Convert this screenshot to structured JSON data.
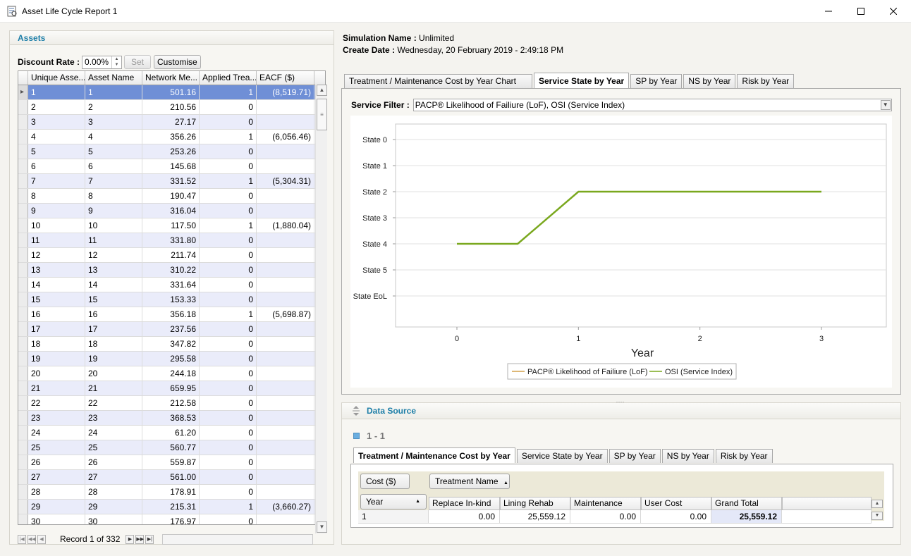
{
  "window": {
    "title": "Asset Life Cycle Report 1",
    "minimize_icon": "minimize-icon",
    "maximize_icon": "maximize-icon",
    "close_icon": "close-icon"
  },
  "assets": {
    "header": "Assets",
    "discount_rate_label": "Discount Rate :",
    "discount_rate_value": "0.00%",
    "set_label": "Set",
    "customise_label": "Customise",
    "columns": [
      "Unique Asse...",
      "Asset Name",
      "Network Me...",
      "Applied Trea...",
      "EACF ($)"
    ],
    "rows": [
      [
        "1",
        "1",
        "501.16",
        "1",
        "(8,519.71)"
      ],
      [
        "2",
        "2",
        "210.56",
        "0",
        ""
      ],
      [
        "3",
        "3",
        "27.17",
        "0",
        ""
      ],
      [
        "4",
        "4",
        "356.26",
        "1",
        "(6,056.46)"
      ],
      [
        "5",
        "5",
        "253.26",
        "0",
        ""
      ],
      [
        "6",
        "6",
        "145.68",
        "0",
        ""
      ],
      [
        "7",
        "7",
        "331.52",
        "1",
        "(5,304.31)"
      ],
      [
        "8",
        "8",
        "190.47",
        "0",
        ""
      ],
      [
        "9",
        "9",
        "316.04",
        "0",
        ""
      ],
      [
        "10",
        "10",
        "117.50",
        "1",
        "(1,880.04)"
      ],
      [
        "11",
        "11",
        "331.80",
        "0",
        ""
      ],
      [
        "12",
        "12",
        "211.74",
        "0",
        ""
      ],
      [
        "13",
        "13",
        "310.22",
        "0",
        ""
      ],
      [
        "14",
        "14",
        "331.64",
        "0",
        ""
      ],
      [
        "15",
        "15",
        "153.33",
        "0",
        ""
      ],
      [
        "16",
        "16",
        "356.18",
        "1",
        "(5,698.87)"
      ],
      [
        "17",
        "17",
        "237.56",
        "0",
        ""
      ],
      [
        "18",
        "18",
        "347.82",
        "0",
        ""
      ],
      [
        "19",
        "19",
        "295.58",
        "0",
        ""
      ],
      [
        "20",
        "20",
        "244.18",
        "0",
        ""
      ],
      [
        "21",
        "21",
        "659.95",
        "0",
        ""
      ],
      [
        "22",
        "22",
        "212.58",
        "0",
        ""
      ],
      [
        "23",
        "23",
        "368.53",
        "0",
        ""
      ],
      [
        "24",
        "24",
        "61.20",
        "0",
        ""
      ],
      [
        "25",
        "25",
        "560.77",
        "0",
        ""
      ],
      [
        "26",
        "26",
        "559.87",
        "0",
        ""
      ],
      [
        "27",
        "27",
        "561.00",
        "0",
        ""
      ],
      [
        "28",
        "28",
        "178.91",
        "0",
        ""
      ],
      [
        "29",
        "29",
        "215.31",
        "1",
        "(3,660.27)"
      ],
      [
        "30",
        "30",
        "176.97",
        "0",
        ""
      ]
    ],
    "record_text": "Record 1 of 332"
  },
  "simulation": {
    "name_label": "Simulation Name :",
    "name_value": "Unlimited",
    "date_label": "Create Date :",
    "date_value": "Wednesday, 20 February 2019 - 2:49:18 PM"
  },
  "chart_tabs": [
    "Treatment / Maintenance Cost by Year Chart",
    "Service State by Year",
    "SP by Year",
    "NS by Year",
    "Risk by Year"
  ],
  "chart_tabs_active": 1,
  "service_filter": {
    "label": "Service Filter :",
    "value": "PACP® Likelihood of Failiure (LoF), OSI (Service Index)"
  },
  "chart_data": {
    "type": "line",
    "xlabel": "Year",
    "ylabel": "",
    "x_ticks": [
      "0",
      "1",
      "2",
      "3"
    ],
    "y_categories": [
      "State 0",
      "State 1",
      "State 2",
      "State 3",
      "State 4",
      "State 5",
      "State EoL"
    ],
    "series": [
      {
        "name": "PACP® Likelihood of Failiure (LoF)",
        "color": "#d4a04a",
        "points": []
      },
      {
        "name": "OSI (Service Index)",
        "color": "#7aa81e",
        "points": [
          [
            0,
            "State 4"
          ],
          [
            0.5,
            "State 4"
          ],
          [
            1,
            "State 2"
          ],
          [
            2,
            "State 2"
          ],
          [
            3,
            "State 2"
          ]
        ]
      }
    ],
    "legend_position": "bottom",
    "grid": true
  },
  "data_source": {
    "header": "Data Source",
    "group_label": "1 - 1",
    "tabs": [
      "Treatment / Maintenance Cost by Year",
      "Service State by Year",
      "SP by Year",
      "NS by Year",
      "Risk by Year"
    ],
    "active_tab": 0,
    "pivot": {
      "data_field": "Cost ($)",
      "column_field": "Treatment Name",
      "row_field": "Year",
      "columns": [
        "Replace In-kind",
        "Lining Rehab",
        "Maintenance Cost",
        "User Cost",
        "Grand Total"
      ],
      "rows": [
        {
          "year": "1",
          "values": [
            "0.00",
            "25,559.12",
            "0.00",
            "0.00",
            "25,559.12"
          ]
        }
      ]
    }
  }
}
